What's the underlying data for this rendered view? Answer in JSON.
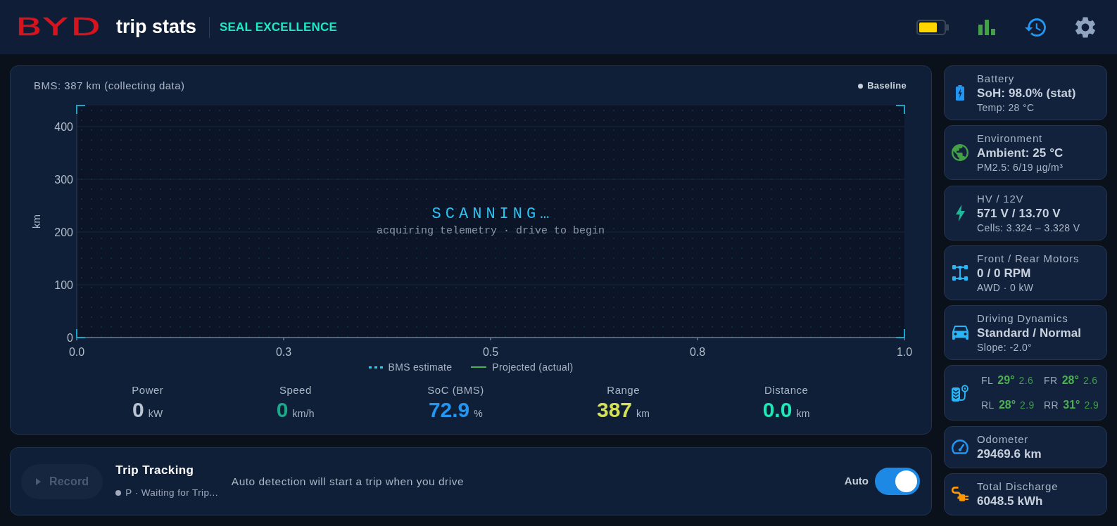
{
  "header": {
    "brand": "BYD",
    "title": "trip stats",
    "model": "SEAL EXCELLENCE"
  },
  "chart_panel": {
    "baseline_label": "Baseline",
    "overlay": {
      "title": "SCANNING…",
      "subtitle": "acquiring telemetry · drive to begin"
    },
    "chart_data": {
      "type": "line",
      "title": "BMS: 387 km (collecting data)",
      "ylabel": "km",
      "categories": [
        "0.0",
        "0.3",
        "0.5",
        "0.8",
        "1.0"
      ],
      "ylim": [
        0,
        440
      ],
      "yticks": [
        0,
        100,
        200,
        300,
        400
      ],
      "grid": true,
      "series": [
        {
          "name": "BMS estimate",
          "color": "#22d3ee",
          "values": [
            null,
            null,
            null,
            null,
            null
          ]
        },
        {
          "name": "Projected (actual)",
          "color": "#4caf50",
          "values": [
            null,
            null,
            null,
            null,
            null
          ]
        }
      ]
    },
    "stats": [
      {
        "label": "Power",
        "value": "0",
        "unit": "kW",
        "color": "#b9c3d1"
      },
      {
        "label": "Speed",
        "value": "0",
        "unit": "km/h",
        "color": "#1ba98a"
      },
      {
        "label": "SoC (BMS)",
        "value": "72.9",
        "unit": "%",
        "color": "#2196f3"
      },
      {
        "label": "Range",
        "value": "387",
        "unit": "km",
        "color": "#d4e157"
      },
      {
        "label": "Distance",
        "value": "0.0",
        "unit": "km",
        "color": "#1de9b6"
      }
    ]
  },
  "trip_tracking": {
    "record_button": {
      "label": "Record",
      "disabled": true
    },
    "title": "Trip Tracking",
    "status": "P · Waiting for Trip...",
    "message": "Auto detection will start a trip when you drive",
    "auto_toggle": {
      "label": "Auto",
      "on": true
    }
  },
  "sidebar": {
    "cards": [
      {
        "kind": "stat",
        "label": "Battery",
        "value": "SoH: 98.0% (stat)",
        "detail": "Temp: 28 °C"
      },
      {
        "kind": "stat",
        "label": "Environment",
        "value": "Ambient: 25 °C",
        "detail": "PM2.5: 6/19 µg/m³"
      },
      {
        "kind": "stat",
        "label": "HV / 12V",
        "value": "571 V / 13.70 V",
        "detail": "Cells: 3.324 – 3.328 V"
      },
      {
        "kind": "stat",
        "label": "Front / Rear Motors",
        "value": "0 / 0 RPM",
        "detail": "AWD · 0 kW"
      },
      {
        "kind": "stat",
        "label": "Driving Dynamics",
        "value": "Standard / Normal",
        "detail": "Slope: -2.0°"
      },
      {
        "kind": "tires",
        "tires": [
          {
            "position": "FL",
            "temperature": "29°",
            "pressure": "2.6"
          },
          {
            "position": "FR",
            "temperature": "28°",
            "pressure": "2.6"
          },
          {
            "position": "RL",
            "temperature": "28°",
            "pressure": "2.9"
          },
          {
            "position": "RR",
            "temperature": "31°",
            "pressure": "2.9"
          }
        ]
      },
      {
        "kind": "stat",
        "label": "Odometer",
        "value": "29469.6 km"
      },
      {
        "kind": "stat",
        "label": "Total Discharge",
        "value": "6048.5 kWh"
      }
    ]
  }
}
